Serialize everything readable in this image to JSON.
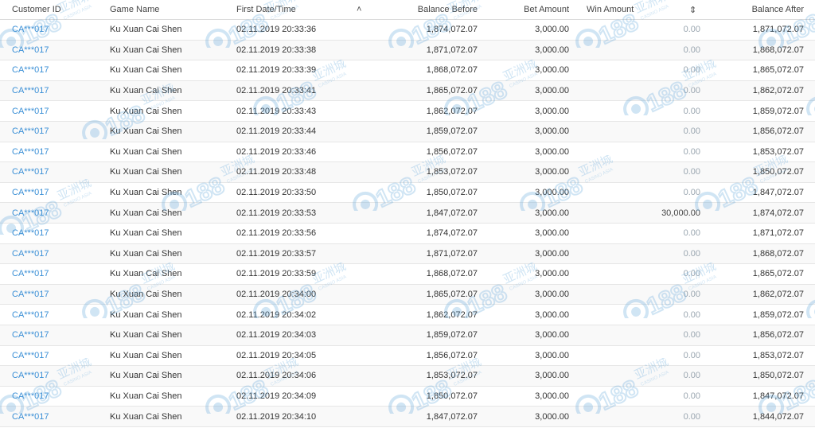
{
  "table": {
    "headers": {
      "customer_id": "Customer ID",
      "game_name": "Game Name",
      "first_date_time": "First Date/Time",
      "sort_up_icon": "˄",
      "balance_before": "Balance Before",
      "bet_amount": "Bet Amount",
      "win_amount": "Win Amount",
      "sort_updown_icon": "⇕",
      "balance_after": "Balance After"
    },
    "rows": [
      {
        "customer_id": "CA***017",
        "game": "Ku Xuan Cai Shen",
        "date": "02.11.2019 20:33:36",
        "balance_before": "1,874,072.07",
        "bet": "3,000.00",
        "win": "0.00",
        "balance_after": "1,871,072.07"
      },
      {
        "customer_id": "CA***017",
        "game": "Ku Xuan Cai Shen",
        "date": "02.11.2019 20:33:38",
        "balance_before": "1,871,072.07",
        "bet": "3,000.00",
        "win": "0.00",
        "balance_after": "1,868,072.07"
      },
      {
        "customer_id": "CA***017",
        "game": "Ku Xuan Cai Shen",
        "date": "02.11.2019 20:33:39",
        "balance_before": "1,868,072.07",
        "bet": "3,000.00",
        "win": "0.00",
        "balance_after": "1,865,072.07"
      },
      {
        "customer_id": "CA***017",
        "game": "Ku Xuan Cai Shen",
        "date": "02.11.2019 20:33:41",
        "balance_before": "1,865,072.07",
        "bet": "3,000.00",
        "win": "0.00",
        "balance_after": "1,862,072.07"
      },
      {
        "customer_id": "CA***017",
        "game": "Ku Xuan Cai Shen",
        "date": "02.11.2019 20:33:43",
        "balance_before": "1,862,072.07",
        "bet": "3,000.00",
        "win": "0.00",
        "balance_after": "1,859,072.07"
      },
      {
        "customer_id": "CA***017",
        "game": "Ku Xuan Cai Shen",
        "date": "02.11.2019 20:33:44",
        "balance_before": "1,859,072.07",
        "bet": "3,000.00",
        "win": "0.00",
        "balance_after": "1,856,072.07"
      },
      {
        "customer_id": "CA***017",
        "game": "Ku Xuan Cai Shen",
        "date": "02.11.2019 20:33:46",
        "balance_before": "1,856,072.07",
        "bet": "3,000.00",
        "win": "0.00",
        "balance_after": "1,853,072.07"
      },
      {
        "customer_id": "CA***017",
        "game": "Ku Xuan Cai Shen",
        "date": "02.11.2019 20:33:48",
        "balance_before": "1,853,072.07",
        "bet": "3,000.00",
        "win": "0.00",
        "balance_after": "1,850,072.07"
      },
      {
        "customer_id": "CA***017",
        "game": "Ku Xuan Cai Shen",
        "date": "02.11.2019 20:33:50",
        "balance_before": "1,850,072.07",
        "bet": "3,000.00",
        "win": "0.00",
        "balance_after": "1,847,072.07"
      },
      {
        "customer_id": "CA***017",
        "game": "Ku Xuan Cai Shen",
        "date": "02.11.2019 20:33:53",
        "balance_before": "1,847,072.07",
        "bet": "3,000.00",
        "win": "30,000.00",
        "balance_after": "1,874,072.07"
      },
      {
        "customer_id": "CA***017",
        "game": "Ku Xuan Cai Shen",
        "date": "02.11.2019 20:33:56",
        "balance_before": "1,874,072.07",
        "bet": "3,000.00",
        "win": "0.00",
        "balance_after": "1,871,072.07"
      },
      {
        "customer_id": "CA***017",
        "game": "Ku Xuan Cai Shen",
        "date": "02.11.2019 20:33:57",
        "balance_before": "1,871,072.07",
        "bet": "3,000.00",
        "win": "0.00",
        "balance_after": "1,868,072.07"
      },
      {
        "customer_id": "CA***017",
        "game": "Ku Xuan Cai Shen",
        "date": "02.11.2019 20:33:59",
        "balance_before": "1,868,072.07",
        "bet": "3,000.00",
        "win": "0.00",
        "balance_after": "1,865,072.07"
      },
      {
        "customer_id": "CA***017",
        "game": "Ku Xuan Cai Shen",
        "date": "02.11.2019 20:34:00",
        "balance_before": "1,865,072.07",
        "bet": "3,000.00",
        "win": "0.00",
        "balance_after": "1,862,072.07"
      },
      {
        "customer_id": "CA***017",
        "game": "Ku Xuan Cai Shen",
        "date": "02.11.2019 20:34:02",
        "balance_before": "1,862,072.07",
        "bet": "3,000.00",
        "win": "0.00",
        "balance_after": "1,859,072.07"
      },
      {
        "customer_id": "CA***017",
        "game": "Ku Xuan Cai Shen",
        "date": "02.11.2019 20:34:03",
        "balance_before": "1,859,072.07",
        "bet": "3,000.00",
        "win": "0.00",
        "balance_after": "1,856,072.07"
      },
      {
        "customer_id": "CA***017",
        "game": "Ku Xuan Cai Shen",
        "date": "02.11.2019 20:34:05",
        "balance_before": "1,856,072.07",
        "bet": "3,000.00",
        "win": "0.00",
        "balance_after": "1,853,072.07"
      },
      {
        "customer_id": "CA***017",
        "game": "Ku Xuan Cai Shen",
        "date": "02.11.2019 20:34:06",
        "balance_before": "1,853,072.07",
        "bet": "3,000.00",
        "win": "0.00",
        "balance_after": "1,850,072.07"
      },
      {
        "customer_id": "CA***017",
        "game": "Ku Xuan Cai Shen",
        "date": "02.11.2019 20:34:09",
        "balance_before": "1,850,072.07",
        "bet": "3,000.00",
        "win": "0.00",
        "balance_after": "1,847,072.07"
      },
      {
        "customer_id": "CA***017",
        "game": "Ku Xuan Cai Shen",
        "date": "02.11.2019 20:34:10",
        "balance_before": "1,847,072.07",
        "bet": "3,000.00",
        "win": "0.00",
        "balance_after": "1,844,072.07"
      }
    ]
  },
  "watermark": {
    "brand": "188",
    "chinese": "亚洲城",
    "tagline": "CASINO ASIA",
    "color": "#5ba3d9"
  },
  "colors": {
    "link": "#3a8fd6",
    "zero_win": "#9aa6b0",
    "row_alt": "#f9f9f9",
    "border": "#e6e6e6"
  }
}
